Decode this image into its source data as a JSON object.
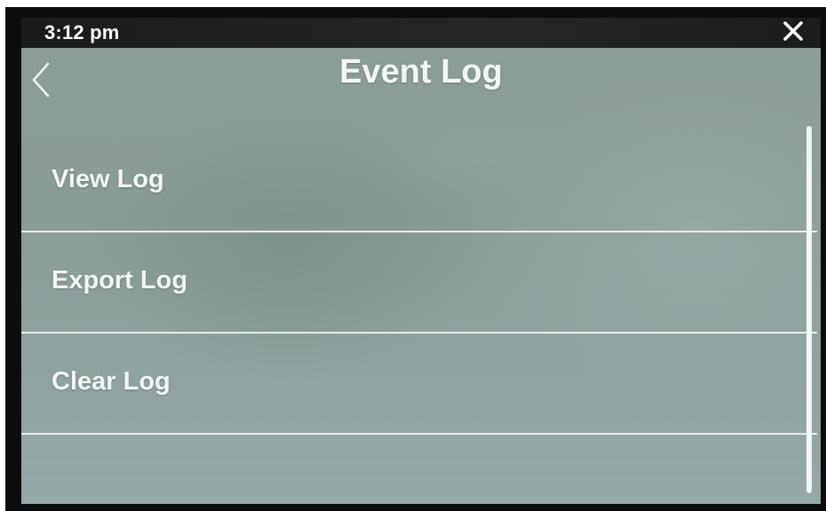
{
  "status_bar": {
    "time": "3:12 pm",
    "close_icon": "close-icon"
  },
  "header": {
    "back_icon": "chevron-left-icon",
    "title": "Event Log"
  },
  "menu": {
    "items": [
      {
        "label": "View Log"
      },
      {
        "label": "Export Log"
      },
      {
        "label": "Clear Log"
      }
    ]
  },
  "colors": {
    "screen_background": "#8d9c99",
    "status_bar": "#1f2021",
    "text": "#f3f5f5",
    "divider": "#e9eeee"
  }
}
